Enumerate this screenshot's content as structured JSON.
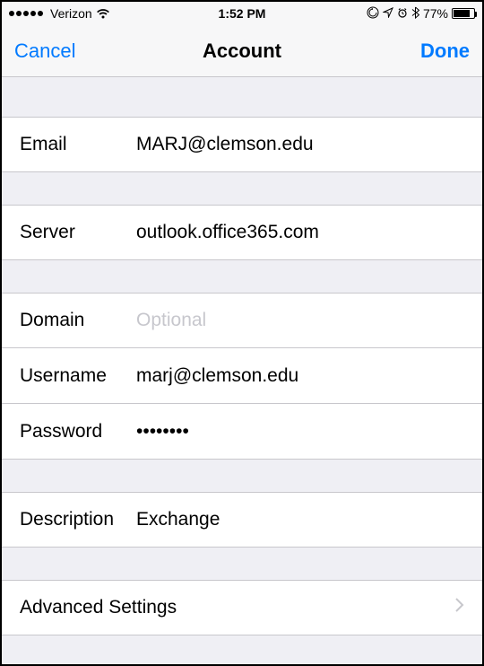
{
  "status": {
    "carrier": "Verizon",
    "time": "1:52 PM",
    "battery_pct": "77%",
    "battery_fill_pct": 77
  },
  "nav": {
    "cancel": "Cancel",
    "title": "Account",
    "done": "Done"
  },
  "fields": {
    "email": {
      "label": "Email",
      "value": "MARJ@clemson.edu"
    },
    "server": {
      "label": "Server",
      "value": "outlook.office365.com"
    },
    "domain": {
      "label": "Domain",
      "value": "",
      "placeholder": "Optional"
    },
    "username": {
      "label": "Username",
      "value": "marj@clemson.edu"
    },
    "password": {
      "label": "Password",
      "value": "••••••••"
    },
    "description": {
      "label": "Description",
      "value": "Exchange"
    }
  },
  "advanced": {
    "label": "Advanced Settings"
  }
}
